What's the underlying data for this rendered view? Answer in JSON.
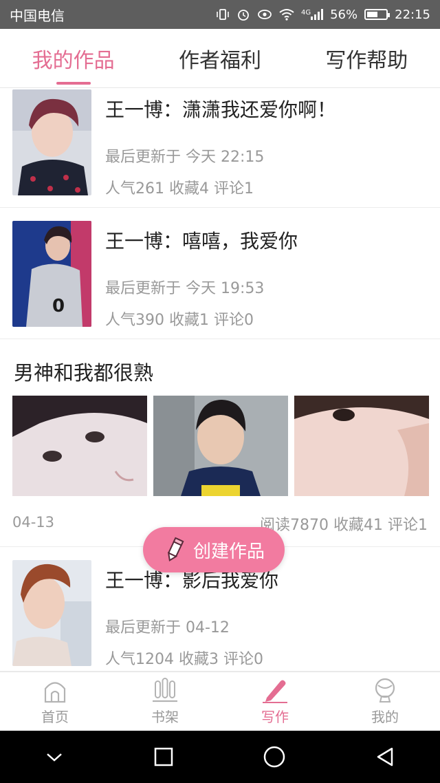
{
  "status_bar": {
    "carrier": "中国电信",
    "network": "4G",
    "battery": "56%",
    "battery_level": 0.56,
    "time": "22:15"
  },
  "tabs": [
    {
      "label": "我的作品",
      "active": true
    },
    {
      "label": "作者福利",
      "active": false
    },
    {
      "label": "写作帮助",
      "active": false
    }
  ],
  "works": [
    {
      "title": "王一博：潇潇我还爱你啊！",
      "updated": "最后更新于 今天 22:15",
      "stats": "人气261 收藏4 评论1"
    },
    {
      "title": "王一博：嘻嘻，我爱你",
      "updated": "最后更新于 今天 19:53",
      "stats": "人气390 收藏1 评论0"
    },
    {
      "title": "王一博：影后我爱你",
      "updated": "最后更新于 04-12",
      "stats": "人气1204 收藏3 评论0"
    }
  ],
  "feature": {
    "title": "男神和我都很熟",
    "date": "04-13",
    "stats": "阅读7870 收藏41 评论1"
  },
  "create_button": {
    "label": "创建作品"
  },
  "bottom_nav": [
    {
      "label": "首页",
      "icon": "home-icon",
      "active": false
    },
    {
      "label": "书架",
      "icon": "bookshelf-icon",
      "active": false
    },
    {
      "label": "写作",
      "icon": "pen-icon",
      "active": true
    },
    {
      "label": "我的",
      "icon": "profile-icon",
      "active": false
    }
  ],
  "colors": {
    "accent": "#e46d92",
    "button": "#f27ba0"
  }
}
